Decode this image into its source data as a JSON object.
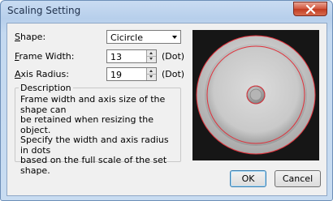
{
  "dialog": {
    "title": "Scaling Setting"
  },
  "fields": {
    "shape": {
      "label": "hape:",
      "accel": "S",
      "value": "Cicircle"
    },
    "frame_width": {
      "label": "rame Width:",
      "accel": "F",
      "value": "13",
      "unit": "(Dot)"
    },
    "axis_radius": {
      "label": "xis Radius:",
      "accel": "A",
      "value": "19",
      "unit": "(Dot)"
    }
  },
  "description": {
    "title": "Description",
    "lines": [
      "Frame width and axis size of the shape can",
      "be retained when resizing the object.",
      "Specify the width and axis radius in dots",
      "based on the full scale of the set shape."
    ]
  },
  "buttons": {
    "ok": "OK",
    "cancel": "Cancel"
  },
  "colors": {
    "guide_line": "#e0303a",
    "preview_bg": "#161616"
  }
}
